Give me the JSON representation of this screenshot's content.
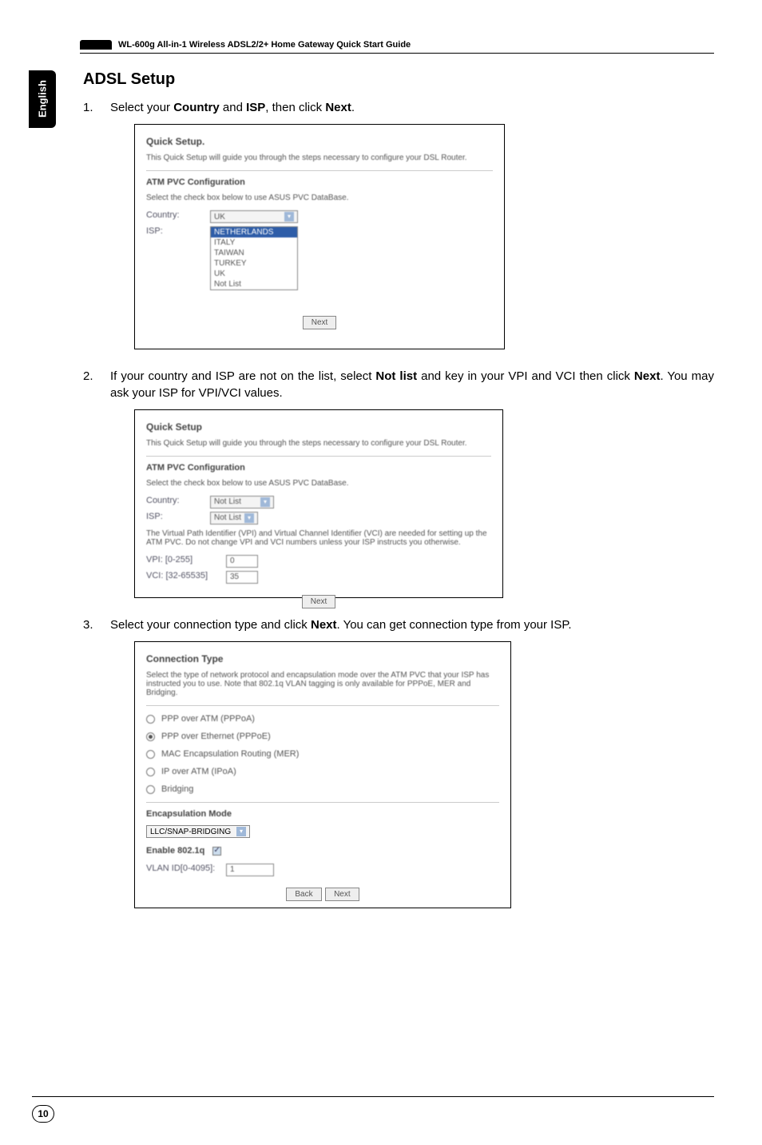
{
  "header": {
    "product_line": "WL-600g All-in-1 Wireless ADSL2/2+ Home Gateway Quick Start Guide"
  },
  "side_tab": "English",
  "section_heading": "ADSL Setup",
  "steps": {
    "s1": {
      "num": "1.",
      "pre": "Select your ",
      "b1": "Country",
      "mid": " and ",
      "b2": "ISP",
      "mid2": ", then click ",
      "b3": "Next",
      "post": "."
    },
    "s2": {
      "num": "2.",
      "pre": "If your country and ISP are not on the list, select ",
      "b1": "Not list",
      "mid": " and key in your VPI and VCI then click ",
      "b2": "Next",
      "post": ". You may ask your ISP for VPI/VCI values."
    },
    "s3": {
      "num": "3.",
      "pre": "Select your connection type and click ",
      "b1": "Next",
      "post": ". You can get connection type from your ISP."
    }
  },
  "shot1": {
    "title": "Quick Setup.",
    "desc": "This Quick Setup will guide you through the steps necessary to configure your DSL Router.",
    "sub": "ATM PVC Configuration",
    "hint": "Select the check box below to use ASUS PVC DataBase.",
    "country_label": "Country:",
    "isp_label": "ISP:",
    "country_value": "UK",
    "isp_options": [
      "NETHERLANDS",
      "ITALY",
      "TAIWAN",
      "TURKEY",
      "UK",
      "Not List"
    ],
    "next_btn": "Next"
  },
  "shot2": {
    "title": "Quick Setup",
    "desc": "This Quick Setup will guide you through the steps necessary to configure your DSL Router.",
    "sub": "ATM PVC Configuration",
    "hint": "Select the check box below to use ASUS PVC DataBase.",
    "country_label": "Country:",
    "isp_label": "ISP:",
    "country_value": "Not List",
    "isp_value": "Not List",
    "vp_desc": "The Virtual Path Identifier (VPI) and Virtual Channel Identifier (VCI) are needed for setting up the ATM PVC. Do not change VPI and VCI numbers unless your ISP instructs you otherwise.",
    "vpi_label": "VPI: [0-255]",
    "vci_label": "VCI: [32-65535]",
    "vpi_value": "0",
    "vci_value": "35",
    "next_btn": "Next"
  },
  "shot3": {
    "title": "Connection Type",
    "desc": "Select the type of network protocol and encapsulation mode over the ATM PVC that your ISP has instructed you to use. Note that 802.1q VLAN tagging is only available for PPPoE, MER and Bridging.",
    "r1": "PPP over ATM (PPPoA)",
    "r2": "PPP over Ethernet (PPPoE)",
    "r3": "MAC Encapsulation Routing (MER)",
    "r4": "IP over ATM (IPoA)",
    "r5": "Bridging",
    "encap_label": "Encapsulation Mode",
    "encap_value": "LLC/SNAP-BRIDGING",
    "enable_label": "Enable 802.1q",
    "vlan_label": "VLAN ID[0-4095]:",
    "vlan_value": "1",
    "back_btn": "Back",
    "next_btn": "Next"
  },
  "page_number": "10"
}
